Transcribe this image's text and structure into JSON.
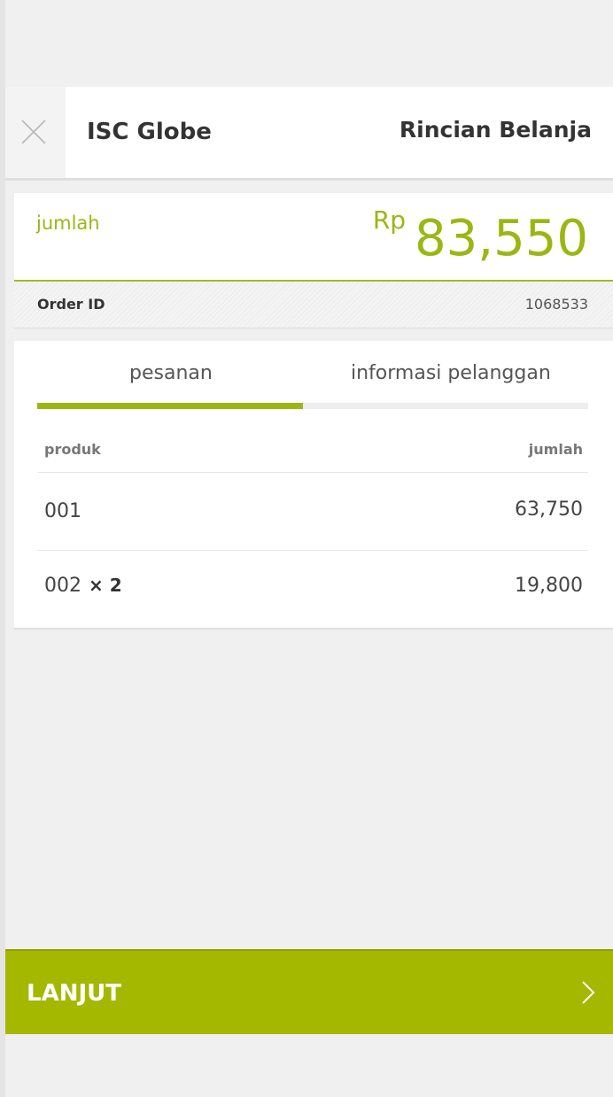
{
  "header": {
    "app_title": "ISC Globe",
    "page_title": "Rincian Belanja",
    "close_icon": "close-icon"
  },
  "summary": {
    "amount_label": "jumlah",
    "currency": "Rp",
    "amount": "83,550",
    "order_id_label": "Order ID",
    "order_id_value": "1068533"
  },
  "tabs": [
    {
      "label": "pesanan",
      "active": true
    },
    {
      "label": "informasi pelanggan",
      "active": false
    }
  ],
  "table": {
    "columns": [
      "produk",
      "jumlah"
    ],
    "rows": [
      {
        "product": "001",
        "qty": "",
        "amount": "63,750"
      },
      {
        "product": "002",
        "qty": "× 2",
        "amount": "19,800"
      }
    ]
  },
  "footer": {
    "cta_label": "LANJUT",
    "cta_icon": "chevron-right-icon"
  },
  "colors": {
    "accent": "#9ab712",
    "cta_background": "#a5b800",
    "background": "#f0f0f0"
  }
}
